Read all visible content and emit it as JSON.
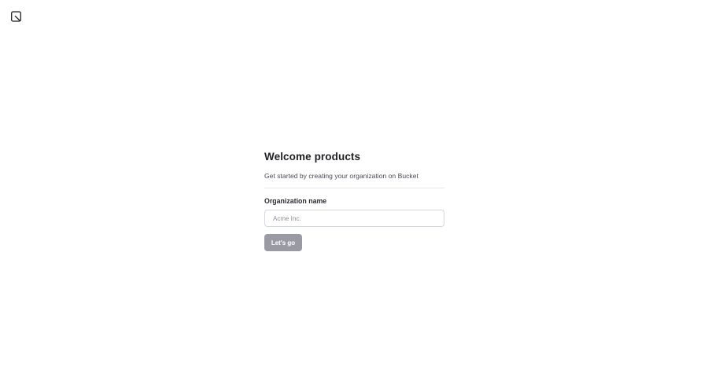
{
  "logo": {
    "icon": "bucket-logo-icon"
  },
  "onboarding": {
    "title": "Welcome products",
    "subtitle": "Get started by creating your organization on Bucket",
    "org_field": {
      "label": "Organization name",
      "placeholder": "Acme Inc.",
      "value": ""
    },
    "submit_label": "Let's go"
  },
  "colors": {
    "button_disabled": "#9a9aa4",
    "text": "#1f1f24",
    "border": "#d7d7de"
  }
}
